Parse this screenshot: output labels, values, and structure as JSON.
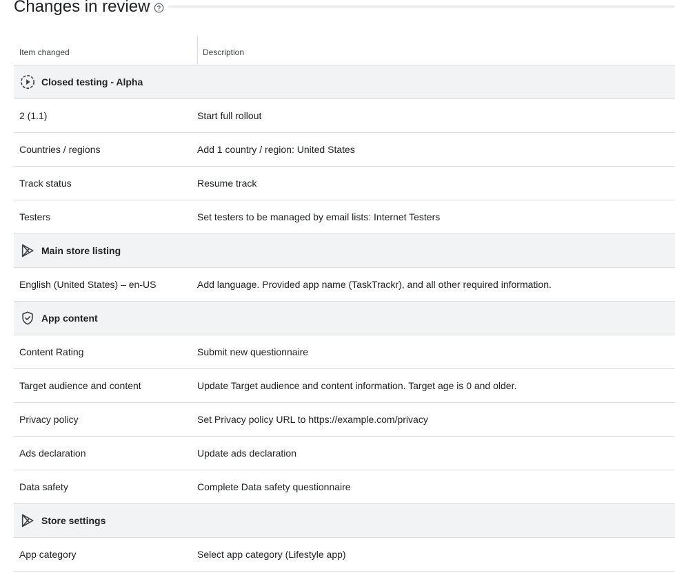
{
  "page": {
    "title": "Changes in review",
    "help_icon": "help-circle-icon"
  },
  "table": {
    "headers": {
      "item": "Item changed",
      "description": "Description"
    },
    "sections": [
      {
        "title": "Closed testing - Alpha",
        "icon": "testing-track-icon",
        "rows": [
          {
            "item": "2 (1.1)",
            "description": "Start full rollout"
          },
          {
            "item": "Countries / regions",
            "description": "Add 1 country / region: United States"
          },
          {
            "item": "Track status",
            "description": "Resume track"
          },
          {
            "item": "Testers",
            "description": "Set testers to be managed by email lists: Internet Testers"
          }
        ]
      },
      {
        "title": "Main store listing",
        "icon": "play-store-icon",
        "rows": [
          {
            "item": "English (United States) – en-US",
            "description": "Add language. Provided app name (TaskTrackr), and all other required information."
          }
        ]
      },
      {
        "title": "App content",
        "icon": "shield-check-icon",
        "rows": [
          {
            "item": "Content Rating",
            "description": "Submit new questionnaire"
          },
          {
            "item": "Target audience and content",
            "description": "Update Target audience and content information. Target age is 0 and older."
          },
          {
            "item": "Privacy policy",
            "description": "Set Privacy policy URL to https://example.com/privacy"
          },
          {
            "item": "Ads declaration",
            "description": "Update ads declaration"
          },
          {
            "item": "Data safety",
            "description": "Complete Data safety questionnaire"
          }
        ]
      },
      {
        "title": "Store settings",
        "icon": "play-store-icon",
        "rows": [
          {
            "item": "App category",
            "description": "Select app category (Lifestyle app)"
          }
        ]
      }
    ]
  }
}
